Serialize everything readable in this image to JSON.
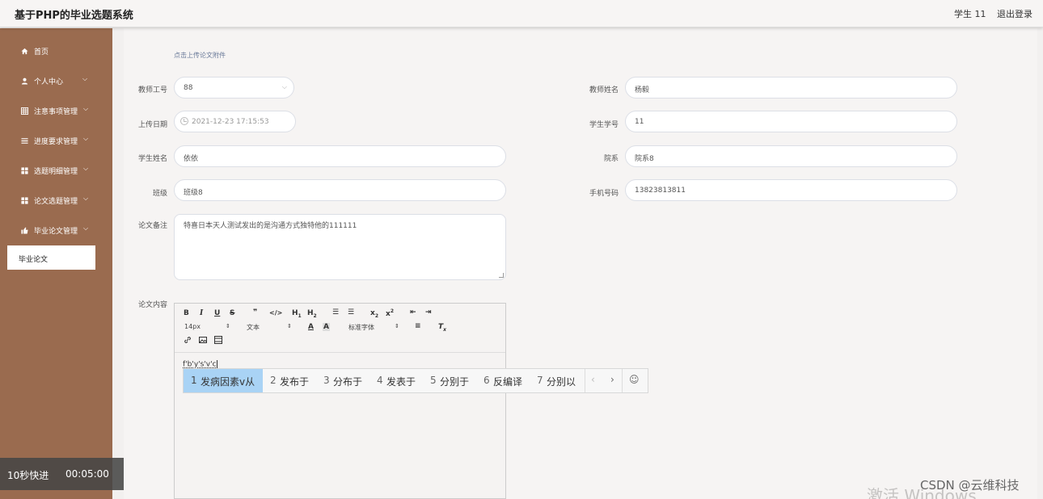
{
  "header": {
    "title": "基于PHP的毕业选题系统",
    "user": "学生 11",
    "logout": "退出登录"
  },
  "sidebar": {
    "items": [
      {
        "label": "首页",
        "icon": "home-icon"
      },
      {
        "label": "个人中心",
        "icon": "user-icon"
      },
      {
        "label": "注意事项管理",
        "icon": "table-icon"
      },
      {
        "label": "进度要求管理",
        "icon": "list-icon"
      },
      {
        "label": "选题明细管理",
        "icon": "grid-icon"
      },
      {
        "label": "论文选题管理",
        "icon": "grid-icon"
      },
      {
        "label": "毕业论文管理",
        "icon": "thumb-icon"
      }
    ],
    "active_sub": "毕业论文"
  },
  "video": {
    "fast_forward": "10秒快进",
    "time": "00:05:00"
  },
  "form": {
    "upload_hint": "点击上传论文附件",
    "teacher_id_label": "教师工号",
    "teacher_id": "88",
    "teacher_name_label": "教师姓名",
    "teacher_name": "杨毅",
    "upload_date_label": "上传日期",
    "upload_date": "2021-12-23 17:15:53",
    "student_id_label": "学生学号",
    "student_id": "11",
    "student_name_label": "学生姓名",
    "student_name": "依依",
    "dept_label": "院系",
    "dept": "院系8",
    "class_label": "班级",
    "class": "班级8",
    "phone_label": "手机号码",
    "phone": "13823813811",
    "remark_label": "论文备注",
    "remark": "特喜日本天人测试发出的是沟通方式独特他的111111",
    "content_label": "论文内容"
  },
  "editor": {
    "font_size": "14px",
    "text_style": "文本",
    "font_family": "标准字体",
    "content": "f'b'y's'v'c"
  },
  "ime": {
    "candidates": [
      {
        "n": "1",
        "text": "发病因素v从"
      },
      {
        "n": "2",
        "text": "发布于"
      },
      {
        "n": "3",
        "text": "分布于"
      },
      {
        "n": "4",
        "text": "发表于"
      },
      {
        "n": "5",
        "text": "分别于"
      },
      {
        "n": "6",
        "text": "反编译"
      },
      {
        "n": "7",
        "text": "分别以"
      }
    ]
  },
  "watermark": {
    "csdn": "CSDN @云维科技",
    "activate": "激活 Windows"
  }
}
